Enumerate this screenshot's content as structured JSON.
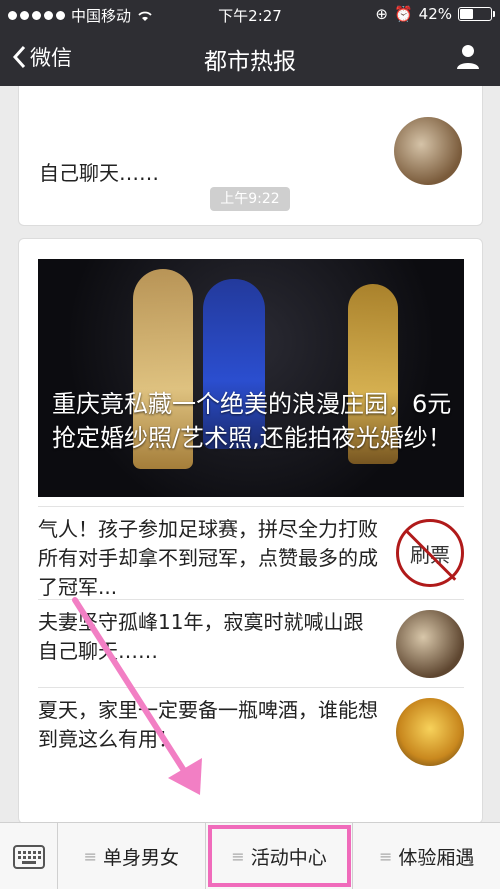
{
  "statusbar": {
    "carrier": "中国移动",
    "time": "下午2:27",
    "battery": "42%",
    "battery_level": 0.42
  },
  "navbar": {
    "back_label": "微信",
    "title": "都市热报"
  },
  "top_card": {
    "text": "自己聊天……"
  },
  "time_pill": "上午9:22",
  "banner": {
    "caption": "重庆竟私藏一个绝美的浪漫庄园，6元抢定婚纱照/艺术照,还能拍夜光婚纱！"
  },
  "items": [
    {
      "text": "气人！孩子参加足球赛，拼尽全力打败所有对手却拿不到冠军，点赞最多的成了冠军...",
      "icon_label": "刷票"
    },
    {
      "text": "夫妻坚守孤峰11年，寂寞时就喊山跟自己聊天……"
    },
    {
      "text": "夏天，家里一定要备一瓶啤酒，谁能想到竟这么有用！"
    }
  ],
  "tabs": [
    {
      "label": "单身男女"
    },
    {
      "label": "活动中心"
    },
    {
      "label": "体验厢遇"
    }
  ],
  "colors": {
    "nav_bg": "#2e2e33",
    "highlight": "#f06bbb",
    "arrow": "#f27fc4"
  }
}
